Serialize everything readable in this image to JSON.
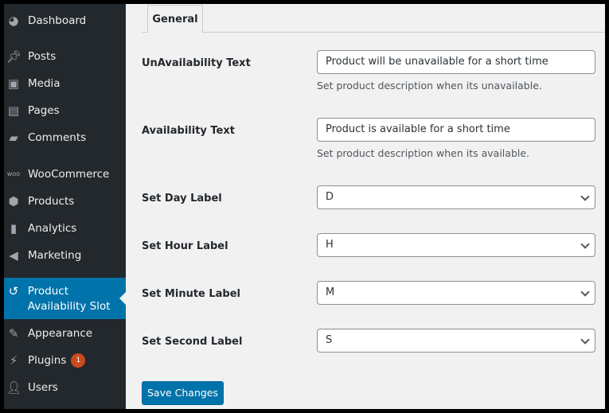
{
  "sidebar": {
    "items": [
      {
        "label": "Dashboard",
        "icon": "dashboard-icon"
      },
      {
        "label": "Posts",
        "icon": "pin-icon"
      },
      {
        "label": "Media",
        "icon": "media-icon"
      },
      {
        "label": "Pages",
        "icon": "pages-icon"
      },
      {
        "label": "Comments",
        "icon": "comment-icon"
      },
      {
        "label": "WooCommerce",
        "icon": "woo-icon"
      },
      {
        "label": "Products",
        "icon": "box-icon"
      },
      {
        "label": "Analytics",
        "icon": "bar-chart-icon"
      },
      {
        "label": "Marketing",
        "icon": "megaphone-icon"
      },
      {
        "label": "Product Availability Slot",
        "icon": "history-icon"
      },
      {
        "label": "Appearance",
        "icon": "brush-icon"
      },
      {
        "label": "Plugins",
        "icon": "plugin-icon",
        "badge": "1"
      },
      {
        "label": "Users",
        "icon": "user-icon"
      }
    ]
  },
  "tab": "General",
  "fields": {
    "unavailability": {
      "label": "UnAvailability Text",
      "value": "Product will be unavailable for a short time",
      "desc": "Set product description when its unavailable."
    },
    "availability": {
      "label": "Availability Text",
      "value": "Product is available for a short time",
      "desc": "Set product description when its available."
    },
    "day": {
      "label": "Set Day Label",
      "value": "D"
    },
    "hour": {
      "label": "Set Hour Label",
      "value": "H"
    },
    "minute": {
      "label": "Set Minute Label",
      "value": "M"
    },
    "second": {
      "label": "Set Second Label",
      "value": "S"
    }
  },
  "save_label": "Save Changes"
}
